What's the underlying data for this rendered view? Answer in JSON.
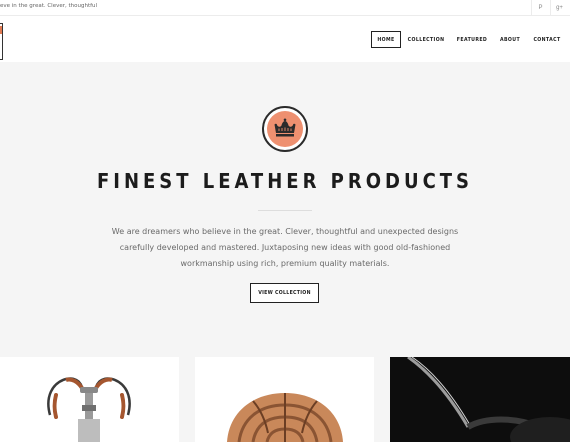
{
  "topbar": {
    "tagline": "eve in the great. Clever, thoughtful",
    "social": [
      {
        "icon": "pinterest-icon",
        "glyph": "P"
      },
      {
        "icon": "google-plus-icon",
        "glyph": "g+"
      }
    ]
  },
  "nav": {
    "items": [
      {
        "label": "HOME",
        "active": true
      },
      {
        "label": "COLLECTION",
        "active": false
      },
      {
        "label": "FEATURED",
        "active": false
      },
      {
        "label": "ABOUT",
        "active": false
      },
      {
        "label": "CONTACT",
        "active": false
      }
    ]
  },
  "hero": {
    "icon": "crown-icon",
    "title": "FINEST LEATHER PRODUCTS",
    "description": "We are dreamers who believe in the great. Clever, thoughtful and unexpected designs carefully developed and mastered. Juxtaposing new ideas with good old-fashioned workmanship using rich, premium quality materials.",
    "button_label": "VIEW COLLECTION"
  },
  "products": [
    {
      "image": "bicycle-handlebar-image"
    },
    {
      "image": "leather-helmet-image"
    },
    {
      "image": "dark-product-image"
    }
  ],
  "colors": {
    "accent": "#ee9070",
    "hero_bg": "#f5f5f5",
    "text_dark": "#1c1c1c",
    "text_muted": "#6a6a6a"
  }
}
